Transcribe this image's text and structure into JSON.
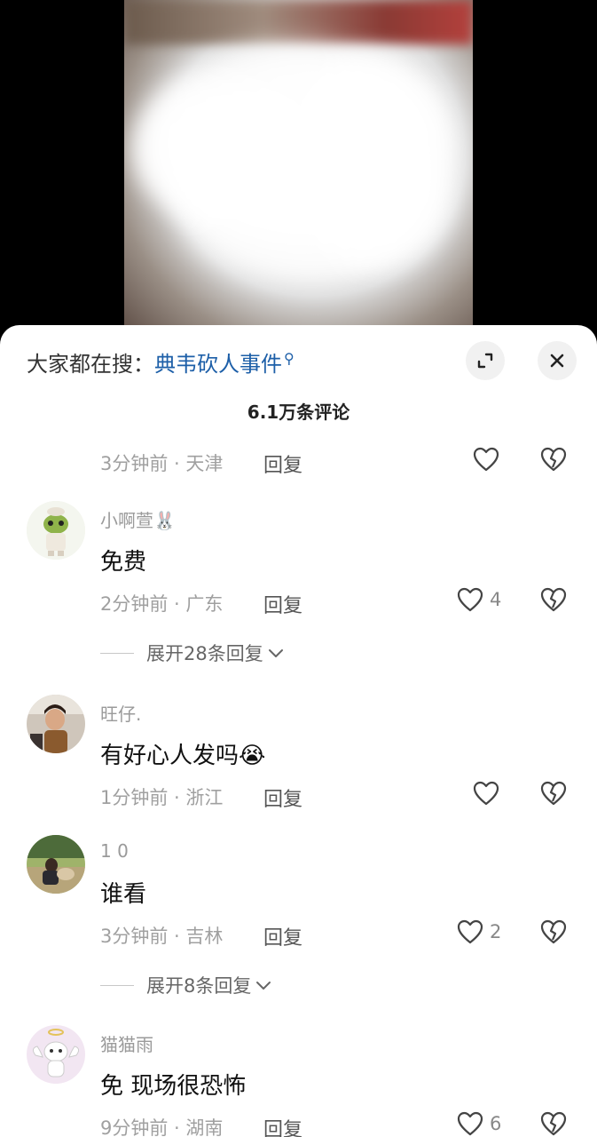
{
  "header": {
    "search_prefix": "大家都在搜：",
    "search_keyword": "典韦砍人事件",
    "comment_count": "6.1万条评论"
  },
  "top_item": {
    "time": "3分钟前",
    "location": "天津",
    "reply": "回复"
  },
  "comments": [
    {
      "username": "小啊萱🐰",
      "content": "免费",
      "time": "2分钟前",
      "location": "广东",
      "reply": "回复",
      "likes": "4",
      "expand": "展开28条回复"
    },
    {
      "username": "旺仔.",
      "content": "有好心人发吗😭",
      "time": "1分钟前",
      "location": "浙江",
      "reply": "回复",
      "likes": ""
    },
    {
      "username": "1 0",
      "content": "谁看",
      "time": "3分钟前",
      "location": "吉林",
      "reply": "回复",
      "likes": "2",
      "expand": "展开8条回复"
    },
    {
      "username": "猫猫雨",
      "content": "免 现场很恐怖",
      "time": "9分钟前",
      "location": "湖南",
      "reply": "回复",
      "likes": "6"
    }
  ],
  "icons": {
    "expand": "expand-icon",
    "close": "close-icon",
    "like": "heart-outline-icon",
    "dislike": "broken-heart-icon",
    "chevron": "chevron-down-icon"
  },
  "colors": {
    "keyword": "#1d5fa8",
    "meta": "#a0a0a0",
    "sheet": "#ffffff"
  }
}
